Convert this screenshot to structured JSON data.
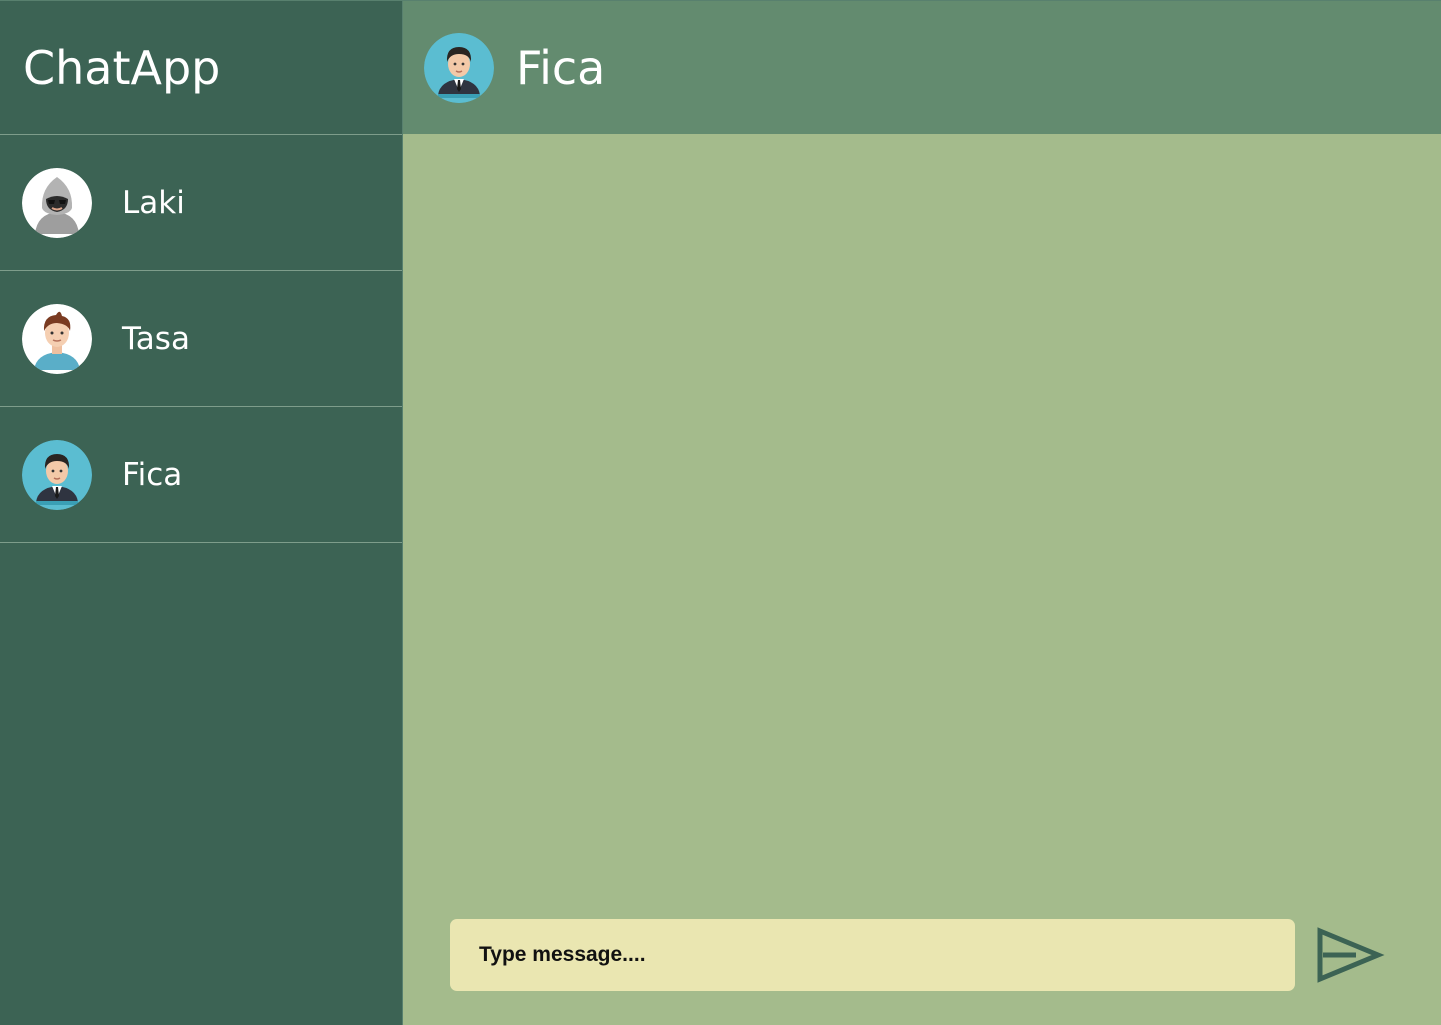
{
  "app": {
    "title": "ChatApp"
  },
  "contacts": [
    {
      "name": "Laki",
      "avatar_icon": "hacker-avatar-icon"
    },
    {
      "name": "Tasa",
      "avatar_icon": "young-man-avatar-icon"
    },
    {
      "name": "Fica",
      "avatar_icon": "businessman-avatar-icon"
    }
  ],
  "chat": {
    "contact_name": "Fica",
    "avatar_icon": "businessman-avatar-icon",
    "messages": []
  },
  "composer": {
    "placeholder": "Type message....",
    "value": "",
    "send_icon": "send-arrow-icon"
  },
  "colors": {
    "sidebar": "#3c6354",
    "header": "#638b6f",
    "chat_background": "#a4bb8c",
    "input_background": "#eae6b1",
    "send_icon": "#3c6354"
  }
}
